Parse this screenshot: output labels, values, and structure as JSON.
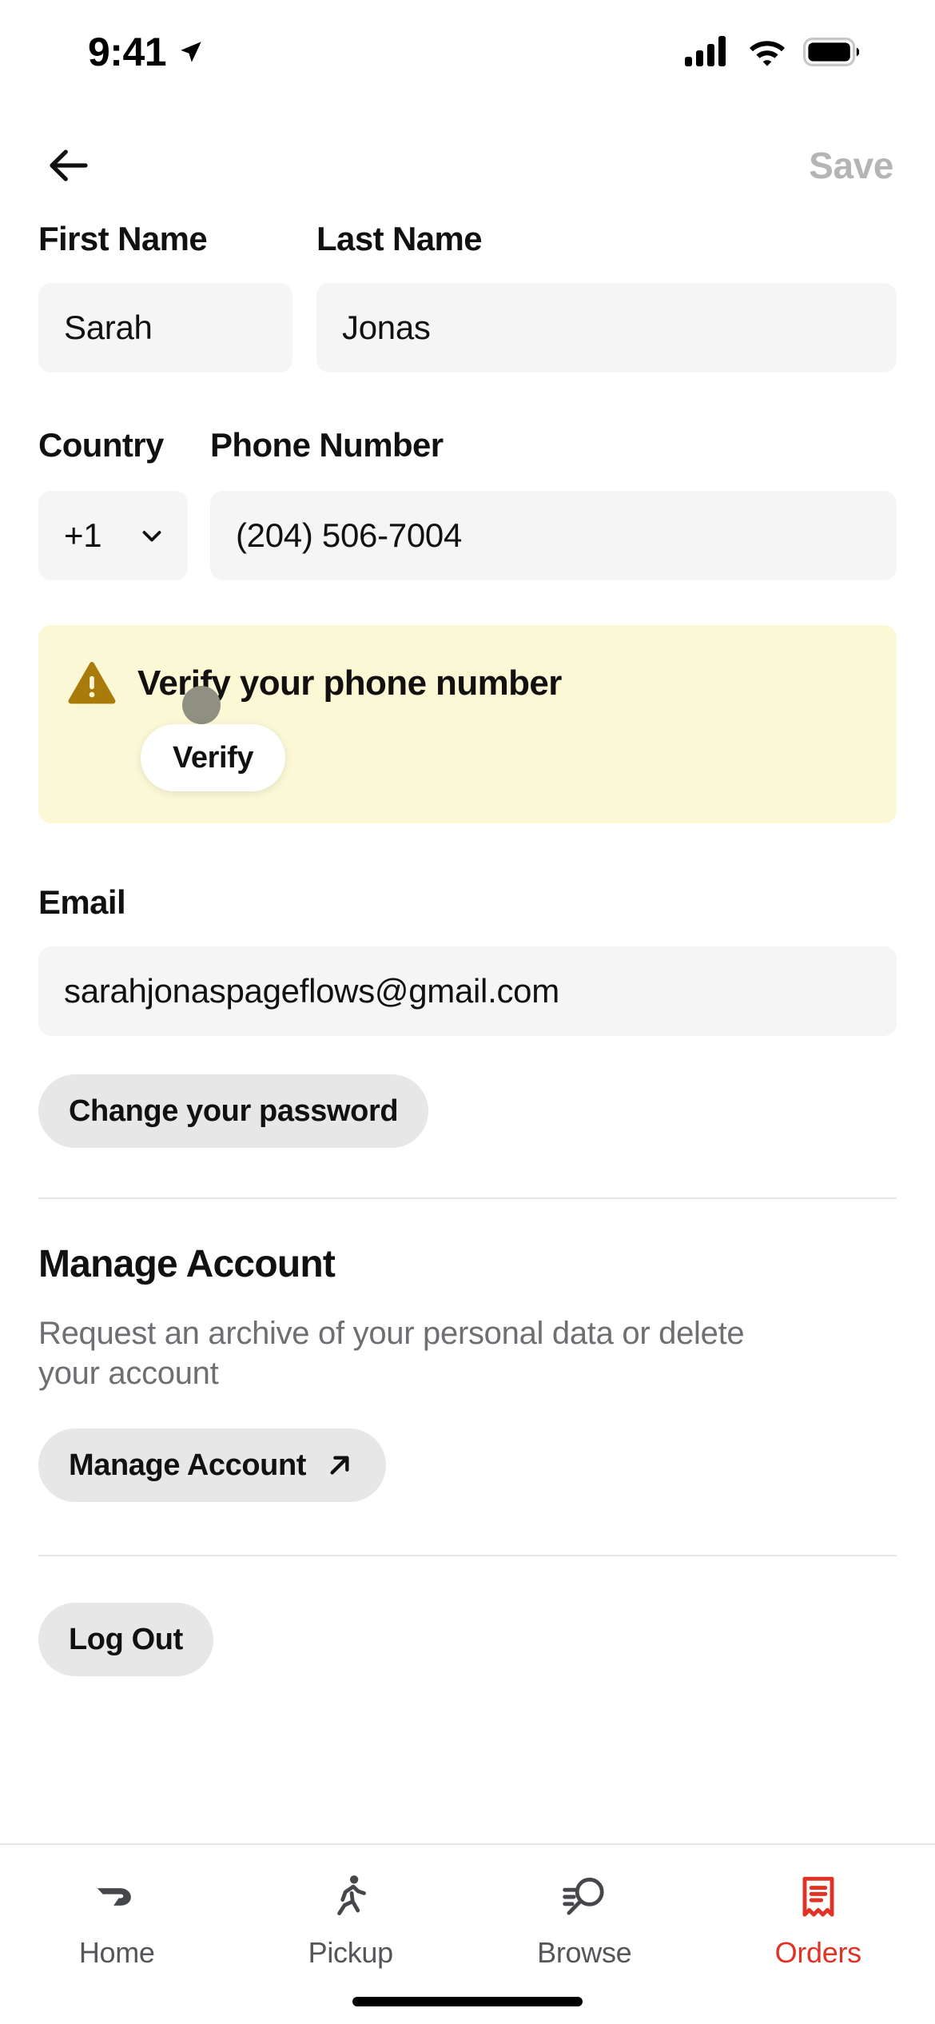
{
  "status_bar": {
    "time": "9:41",
    "location_icon": "location-arrow-icon",
    "signal_icon": "cellular-signal-icon",
    "wifi_icon": "wifi-icon",
    "battery_icon": "battery-full-icon"
  },
  "header": {
    "back_icon": "back-arrow-icon",
    "save_label": "Save",
    "save_color": "#b5b5b5"
  },
  "form": {
    "first_name": {
      "label": "First Name",
      "value": "Sarah"
    },
    "last_name": {
      "label": "Last Name",
      "value": "Jonas"
    },
    "country": {
      "label": "Country",
      "value": "+1",
      "chevron_icon": "chevron-down-icon"
    },
    "phone": {
      "label": "Phone Number",
      "value": "(204) 506-7004"
    },
    "email": {
      "label": "Email",
      "value": "sarahjonaspageflows@gmail.com"
    }
  },
  "verify_banner": {
    "warning_icon": "warning-triangle-icon",
    "title": "Verify your phone number",
    "button_label": "Verify",
    "background_color": "#faf8d5",
    "icon_color": "#a87b0b",
    "tap_indicator_color": "#8f9081"
  },
  "password": {
    "button_label": "Change your password"
  },
  "manage_account": {
    "title": "Manage Account",
    "description": "Request an archive of your personal data or delete your account",
    "button_label": "Manage Account",
    "external_icon": "external-link-arrow-icon"
  },
  "logout": {
    "button_label": "Log Out"
  },
  "tabbar": {
    "active_color": "#e03326",
    "inactive_color": "#55555a",
    "items": [
      {
        "label": "Home",
        "icon": "doordash-home-icon",
        "active": false
      },
      {
        "label": "Pickup",
        "icon": "walking-person-icon",
        "active": false
      },
      {
        "label": "Browse",
        "icon": "search-list-icon",
        "active": false
      },
      {
        "label": "Orders",
        "icon": "receipt-icon",
        "active": true
      }
    ]
  }
}
